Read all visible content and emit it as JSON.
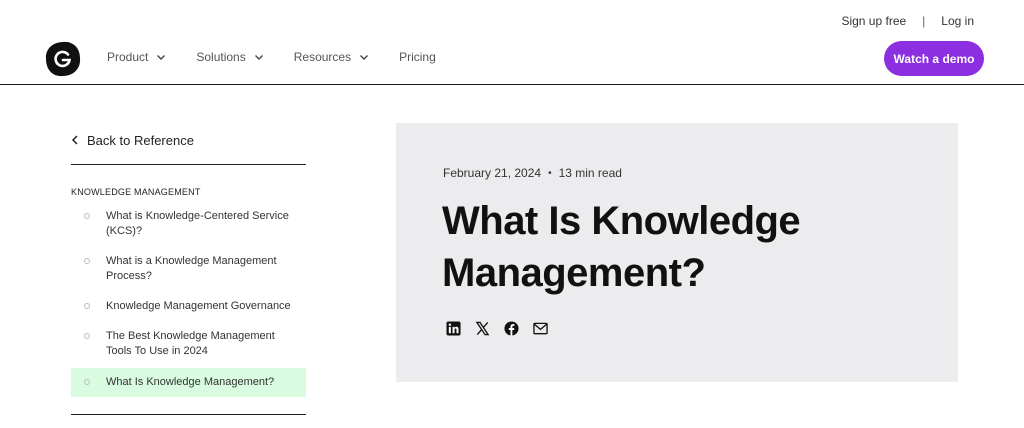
{
  "header": {
    "util_links": {
      "signup": "Sign up free",
      "separator": "|",
      "login": "Log in"
    },
    "logo_icon": "brand-logo-icon",
    "nav": [
      {
        "label": "Product",
        "has_dropdown": true
      },
      {
        "label": "Solutions",
        "has_dropdown": true
      },
      {
        "label": "Resources",
        "has_dropdown": true
      },
      {
        "label": "Pricing",
        "has_dropdown": false
      }
    ],
    "cta_label": "Watch a demo"
  },
  "sidebar": {
    "back_label": "Back to Reference",
    "section_label": "KNOWLEDGE MANAGEMENT",
    "items": [
      {
        "label": "What is Knowledge-Centered Service (KCS)?",
        "active": false
      },
      {
        "label": "What is a Knowledge Management Process?",
        "active": false
      },
      {
        "label": "Knowledge Management Governance",
        "active": false
      },
      {
        "label": "The Best Knowledge Management Tools To Use in 2024",
        "active": false
      },
      {
        "label": "What Is Knowledge Management?",
        "active": true
      }
    ]
  },
  "article": {
    "date": "February 21, 2024",
    "meta_separator": "•",
    "read_time": "13 min read",
    "title": "What Is Knowledge Management?",
    "share_icons": [
      "linkedin-icon",
      "x-icon",
      "facebook-icon",
      "email-icon"
    ]
  },
  "colors": {
    "accent": "#8b2fe0",
    "active_item_bg": "#d9fbe0",
    "hero_bg": "#ececef"
  }
}
